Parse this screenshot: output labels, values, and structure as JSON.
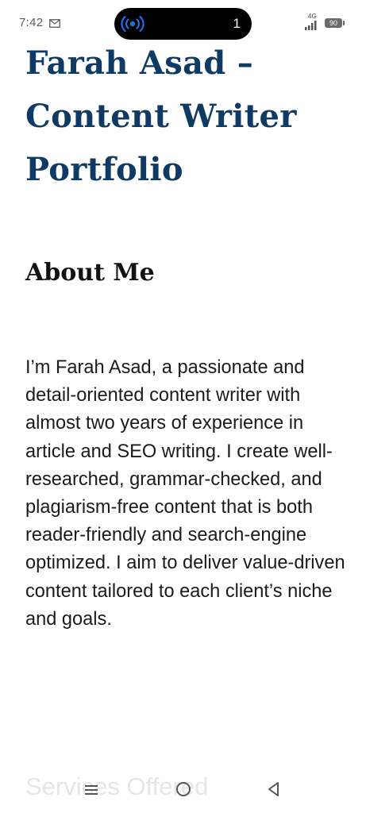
{
  "status_bar": {
    "time": "7:42",
    "live_count": "1",
    "network": "4G",
    "battery": "90",
    "accent_color": "#1e6fe0"
  },
  "content": {
    "title": "Farah Asad – Content Writer Portfolio",
    "about_heading": "About Me",
    "about_text": "I’m Farah Asad, a passionate and detail-oriented content writer with almost two years of experience in article and SEO writing. I create well-researched, grammar-checked, and plagiarism-free content that is both reader-friendly and search-engine optimized. I aim to deliver value-driven content tailored to each client’s niche and goals.",
    "next_heading": "Services Offered"
  },
  "nav_bar": {
    "icons": [
      "menu-icon",
      "home-icon",
      "back-icon"
    ]
  },
  "colors": {
    "title": "#0f3a63",
    "text": "#1b1b1b"
  }
}
